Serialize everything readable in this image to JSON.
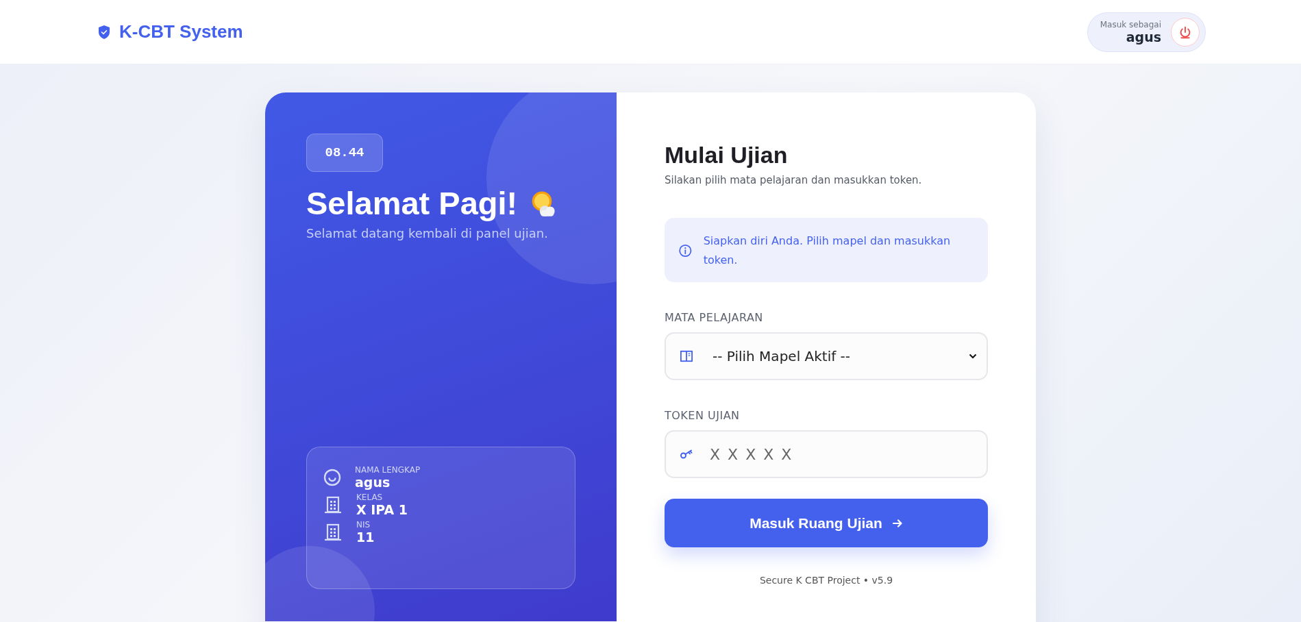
{
  "header": {
    "brand": "K-CBT System",
    "user_label": "Masuk sebagai",
    "user_name": "agus"
  },
  "welcome": {
    "clock": "08.44",
    "greeting": "Selamat Pagi!",
    "subtitle": "Selamat datang kembali di panel ujian.",
    "profile": [
      {
        "kind": "person",
        "label": "NAMA LENGKAP",
        "value": "agus"
      },
      {
        "kind": "building",
        "label": "KELAS",
        "value": "X IPA 1"
      },
      {
        "kind": "building",
        "label": "NIS",
        "value": "11"
      }
    ]
  },
  "form": {
    "title": "Mulai Ujian",
    "subtitle": "Silakan pilih mata pelajaran dan masukkan token.",
    "notice": "Siapkan diri Anda. Pilih mapel dan masukkan token.",
    "subject": {
      "label": "MATA PELAJARAN",
      "value": "-- Pilih Mapel Aktif --"
    },
    "token": {
      "label": "TOKEN UJIAN",
      "placeholder": "X X X X X"
    },
    "submit": "Masuk Ruang Ujian",
    "footer": "Secure K CBT Project • v5.9"
  }
}
